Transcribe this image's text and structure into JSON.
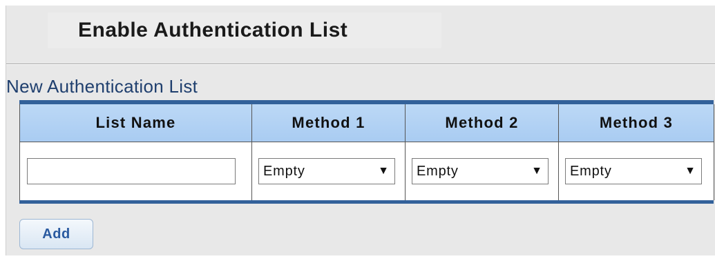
{
  "page": {
    "title": "Enable Authentication List"
  },
  "section": {
    "title": "New Authentication List"
  },
  "table": {
    "headers": [
      "List Name",
      "Method 1",
      "Method 2",
      "Method 3"
    ],
    "row": {
      "list_name": "",
      "method1": "Empty",
      "method2": "Empty",
      "method3": "Empty"
    }
  },
  "actions": {
    "add_label": "Add"
  },
  "icons": {
    "dropdown": "caret-down-icon"
  },
  "colors": {
    "header_bg": "#a9ccf2",
    "table_border": "#33619a",
    "section_title": "#1f3f6e",
    "add_text": "#2a5aa0"
  }
}
